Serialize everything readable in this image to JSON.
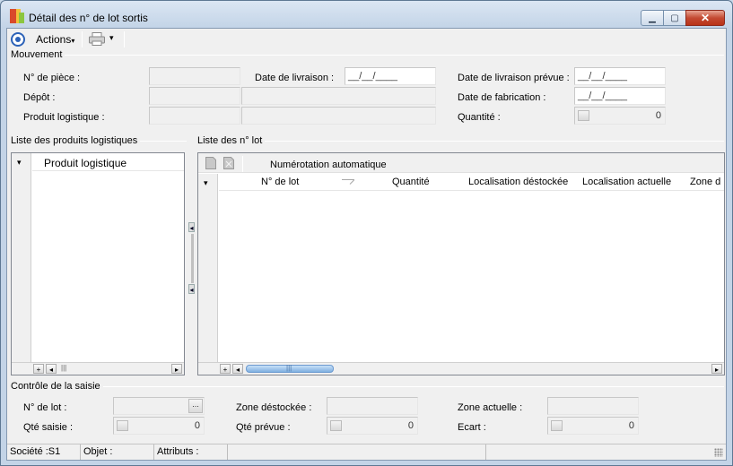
{
  "window": {
    "title": "Détail des n° de lot sortis",
    "controls": {
      "minimize": "▁",
      "maximize": "▢",
      "close": "✕"
    }
  },
  "toolbar": {
    "actions_label": "Actions",
    "actions_caret": "▾",
    "print_caret": "▾"
  },
  "mouvement": {
    "group_title": "Mouvement",
    "num_piece_label": "N° de pièce :",
    "depot_label": "Dépôt :",
    "produit_logistique_label": "Produit logistique :",
    "date_livraison_label": "Date de livraison :",
    "date_livraison_value": "__/__/____",
    "date_livraison_prevue_label": "Date de livraison prévue :",
    "date_livraison_prevue_value": "__/__/____",
    "date_fabrication_label": "Date de fabrication :",
    "date_fabrication_value": "__/__/____",
    "quantite_label": "Quantité :",
    "quantite_value": "0"
  },
  "products_list": {
    "group_title": "Liste des produits logistiques",
    "column": "Produit logistique",
    "row_indicator": "▾",
    "add": "+",
    "left": "◂",
    "right": "▸",
    "grip": "|||"
  },
  "lots_list": {
    "group_title": "Liste des n° lot",
    "auto_numbering_label": "Numérotation automatique",
    "row_indicator": "▾",
    "columns": [
      "N° de lot",
      "Quantité",
      "Localisation déstockée",
      "Localisation actuelle",
      "Zone d"
    ],
    "add": "+",
    "left": "◂",
    "right": "▸",
    "grip": "|||",
    "splitter_left": "◂",
    "splitter_right": "◂"
  },
  "controle": {
    "group_title": "Contrôle de la saisie",
    "num_lot_label": "N° de lot :",
    "ellipsis": "...",
    "qte_saisie_label": "Qté saisie :",
    "qte_saisie_value": "0",
    "zone_destockee_label": "Zone déstockée :",
    "qte_prevue_label": "Qté prévue :",
    "qte_prevue_value": "0",
    "zone_actuelle_label": "Zone actuelle :",
    "ecart_label": "Ecart :",
    "ecart_value": "0"
  },
  "status": {
    "societe": "Société :S1",
    "objet": "Objet :",
    "attributs": "Attributs :"
  }
}
